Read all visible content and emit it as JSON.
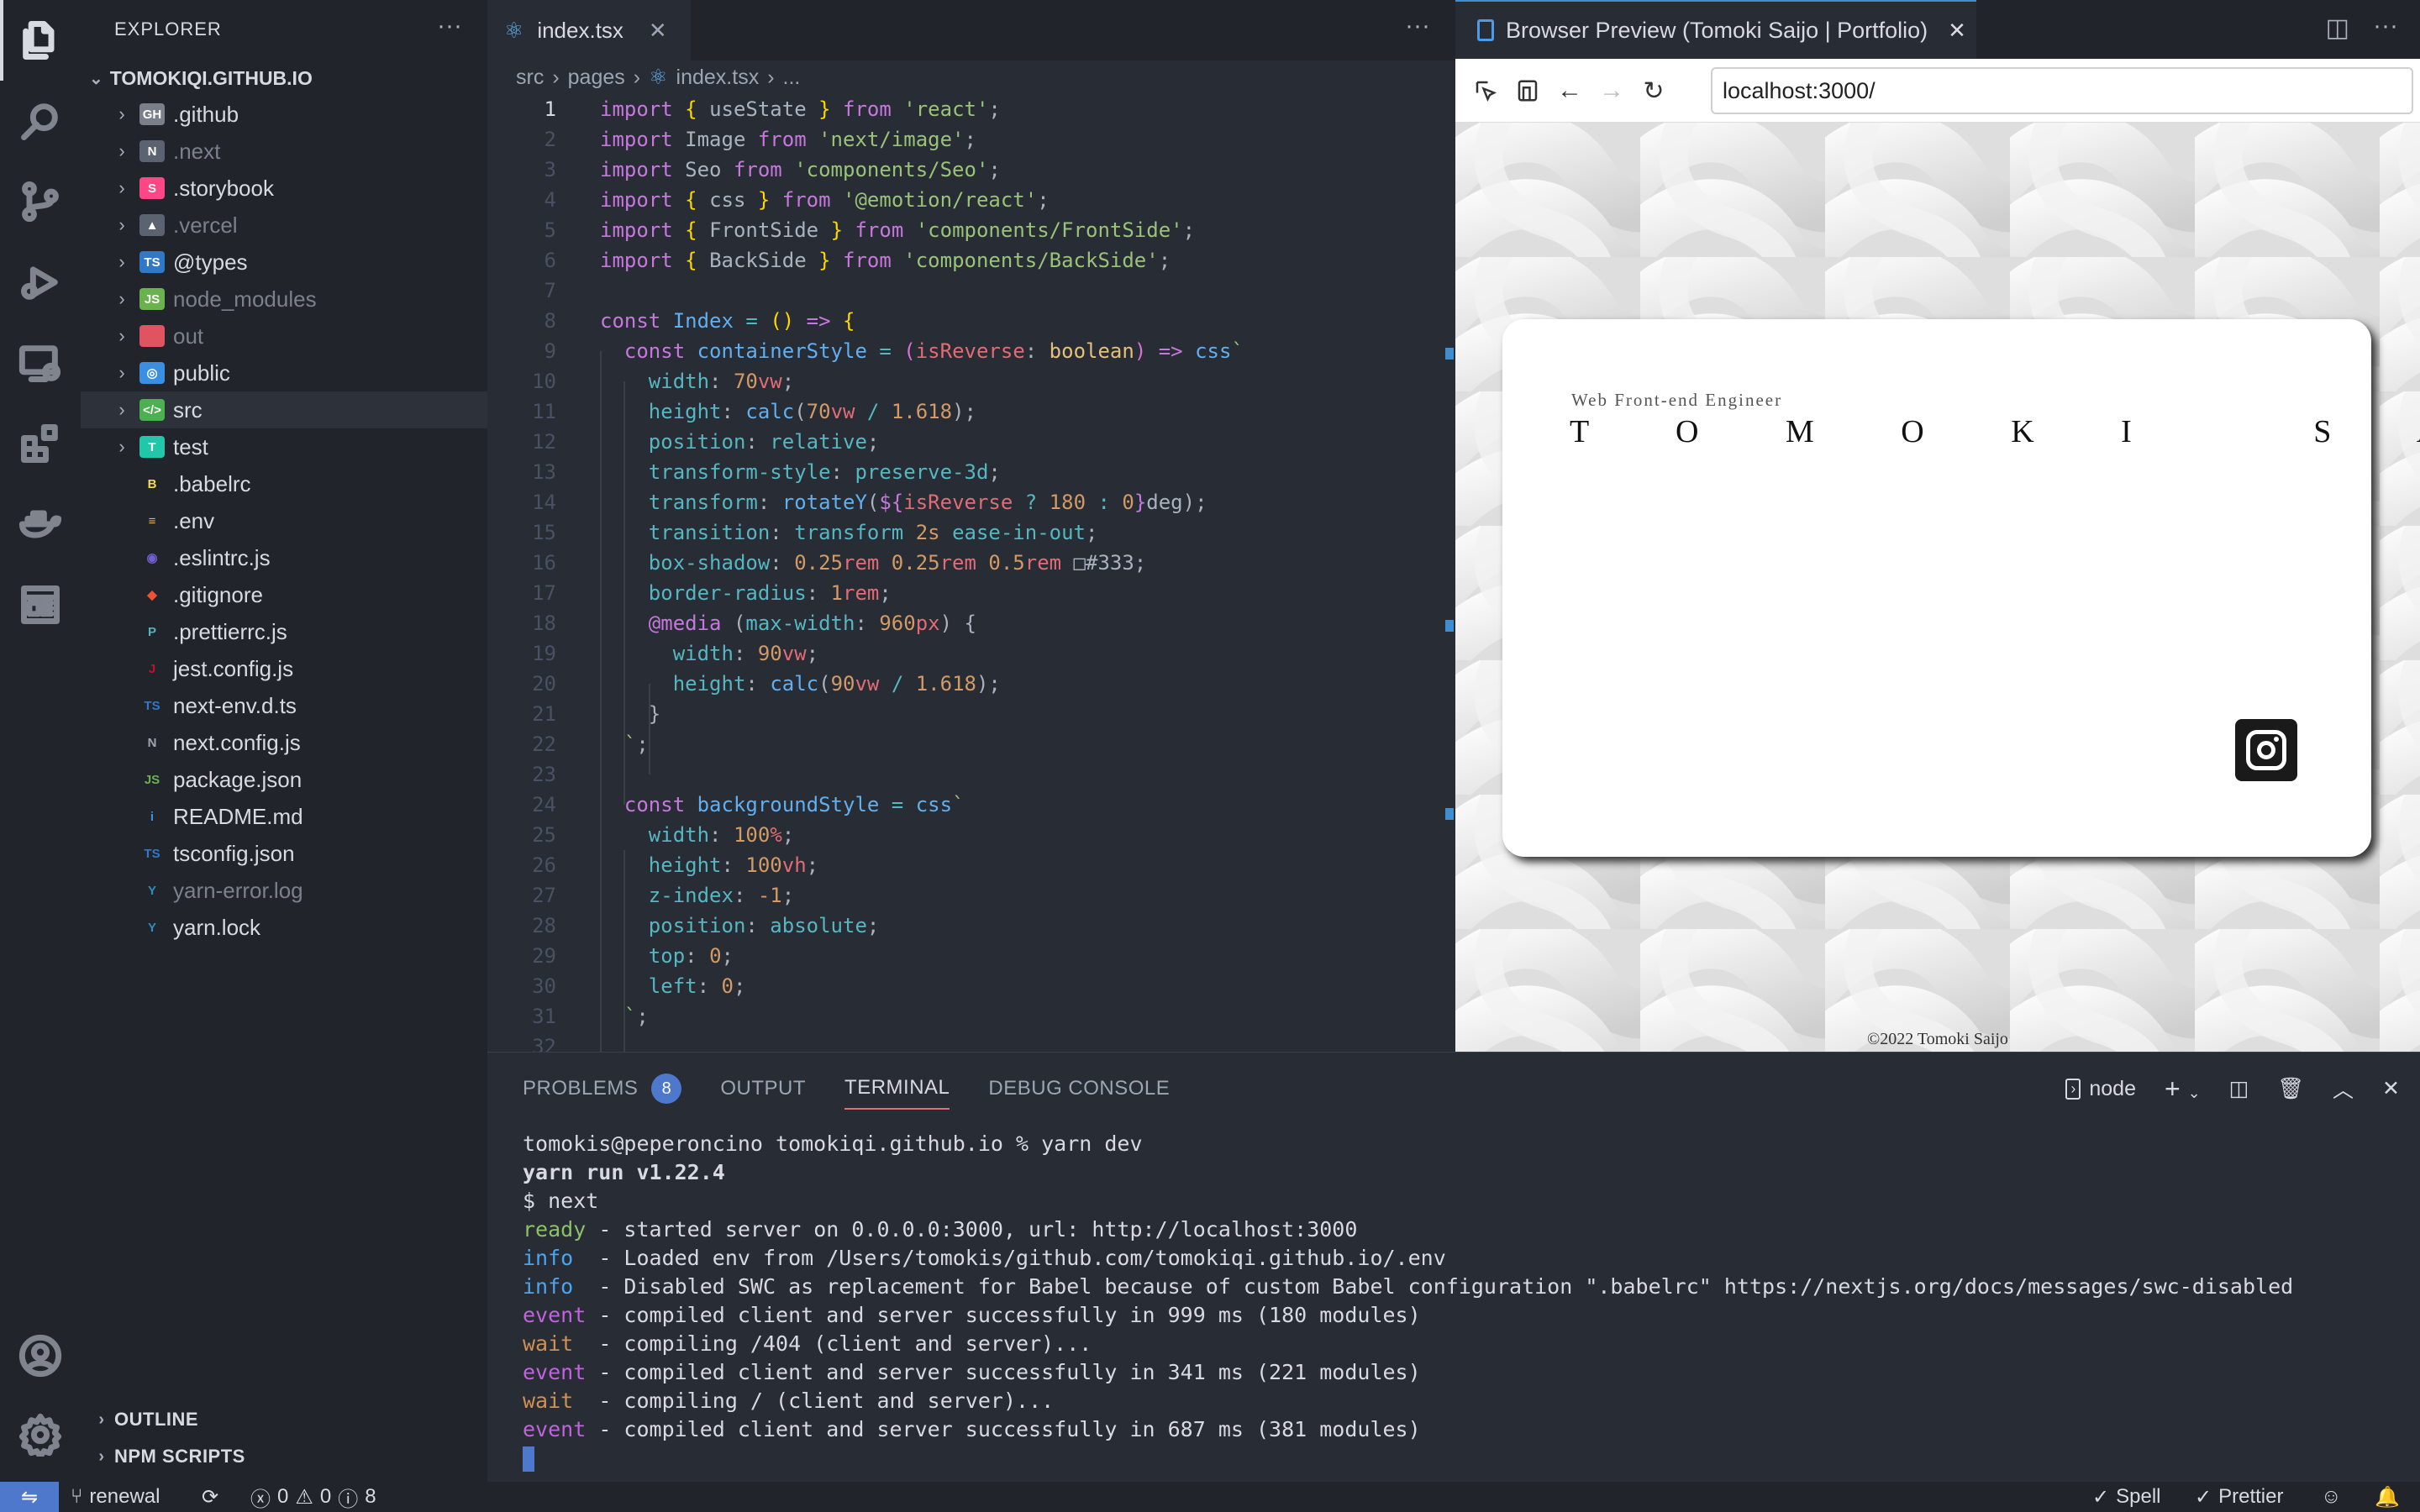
{
  "explorer": {
    "title": "EXPLORER",
    "root": "TOMOKIQI.GITHUB.IO",
    "items": [
      {
        "label": ".github",
        "icon": "GH",
        "color": "#7a7f8a",
        "folder": true,
        "dim": false
      },
      {
        "label": ".next",
        "icon": "N",
        "color": "#5c6370",
        "folder": true,
        "dim": true
      },
      {
        "label": ".storybook",
        "icon": "S",
        "color": "#ff4785",
        "folder": true,
        "dim": false
      },
      {
        "label": ".vercel",
        "icon": "▲",
        "color": "#5c6370",
        "folder": true,
        "dim": true
      },
      {
        "label": "@types",
        "icon": "TS",
        "color": "#3178c6",
        "folder": true,
        "dim": false
      },
      {
        "label": "node_modules",
        "icon": "JS",
        "color": "#6bb24f",
        "folder": true,
        "dim": true
      },
      {
        "label": "out",
        "icon": "",
        "color": "#e05361",
        "folder": true,
        "dim": true
      },
      {
        "label": "public",
        "icon": "◎",
        "color": "#3b8fe0",
        "folder": true,
        "dim": false
      },
      {
        "label": "src",
        "icon": "</>",
        "color": "#4caf50",
        "folder": true,
        "dim": false
      },
      {
        "label": "test",
        "icon": "T",
        "color": "#21c7a8",
        "folder": true,
        "dim": false
      },
      {
        "label": ".babelrc",
        "icon": "B",
        "color": "#f5da55",
        "folder": false,
        "dim": false
      },
      {
        "label": ".env",
        "icon": "≡",
        "color": "#e0b060",
        "folder": false,
        "dim": false
      },
      {
        "label": ".eslintrc.js",
        "icon": "◉",
        "color": "#6f5fd1",
        "folder": false,
        "dim": false
      },
      {
        "label": ".gitignore",
        "icon": "◆",
        "color": "#f05133",
        "folder": false,
        "dim": false
      },
      {
        "label": ".prettierrc.js",
        "icon": "P",
        "color": "#56b3b4",
        "folder": false,
        "dim": false
      },
      {
        "label": "jest.config.js",
        "icon": "J",
        "color": "#c21325",
        "folder": false,
        "dim": false
      },
      {
        "label": "next-env.d.ts",
        "icon": "TS",
        "color": "#3178c6",
        "folder": false,
        "dim": false
      },
      {
        "label": "next.config.js",
        "icon": "N",
        "color": "#9da5b4",
        "folder": false,
        "dim": false
      },
      {
        "label": "package.json",
        "icon": "JS",
        "color": "#6bb24f",
        "folder": false,
        "dim": false
      },
      {
        "label": "README.md",
        "icon": "i",
        "color": "#3b8fe0",
        "folder": false,
        "dim": false
      },
      {
        "label": "tsconfig.json",
        "icon": "TS",
        "color": "#3178c6",
        "folder": false,
        "dim": false
      },
      {
        "label": "yarn-error.log",
        "icon": "Y",
        "color": "#2c8ebb",
        "folder": false,
        "dim": true
      },
      {
        "label": "yarn.lock",
        "icon": "Y",
        "color": "#2c8ebb",
        "folder": false,
        "dim": false
      }
    ],
    "outline": "OUTLINE",
    "npm_scripts": "NPM SCRIPTS"
  },
  "editor": {
    "tab_label": "index.tsx",
    "breadcrumb": [
      "src",
      "pages",
      "index.tsx",
      "..."
    ]
  },
  "code_lines": [
    [
      [
        "k",
        "import "
      ],
      [
        "b1",
        "{ "
      ],
      [
        "p",
        "useState "
      ],
      [
        "b1",
        "} "
      ],
      [
        "k",
        "from "
      ],
      [
        "s",
        "'react'"
      ],
      [
        "p",
        ";"
      ]
    ],
    [
      [
        "k",
        "import "
      ],
      [
        "p",
        "Image "
      ],
      [
        "k",
        "from "
      ],
      [
        "s",
        "'next/image'"
      ],
      [
        "p",
        ";"
      ]
    ],
    [
      [
        "k",
        "import "
      ],
      [
        "p",
        "Seo "
      ],
      [
        "k",
        "from "
      ],
      [
        "s",
        "'components/Seo'"
      ],
      [
        "p",
        ";"
      ]
    ],
    [
      [
        "k",
        "import "
      ],
      [
        "b1",
        "{ "
      ],
      [
        "p",
        "css "
      ],
      [
        "b1",
        "} "
      ],
      [
        "k",
        "from "
      ],
      [
        "s",
        "'@emotion/react'"
      ],
      [
        "p",
        ";"
      ]
    ],
    [
      [
        "k",
        "import "
      ],
      [
        "b1",
        "{ "
      ],
      [
        "p",
        "FrontSide "
      ],
      [
        "b1",
        "} "
      ],
      [
        "k",
        "from "
      ],
      [
        "s",
        "'components/FrontSide'"
      ],
      [
        "p",
        ";"
      ]
    ],
    [
      [
        "k",
        "import "
      ],
      [
        "b1",
        "{ "
      ],
      [
        "p",
        "BackSide "
      ],
      [
        "b1",
        "} "
      ],
      [
        "k",
        "from "
      ],
      [
        "s",
        "'components/BackSide'"
      ],
      [
        "p",
        ";"
      ]
    ],
    [],
    [
      [
        "k",
        "const "
      ],
      [
        "f",
        "Index "
      ],
      [
        "c",
        "= "
      ],
      [
        "b1",
        "() "
      ],
      [
        "k",
        "=> "
      ],
      [
        "b1",
        "{"
      ]
    ],
    [
      [
        "p",
        "  "
      ],
      [
        "k",
        "const "
      ],
      [
        "f",
        "containerStyle "
      ],
      [
        "c",
        "= "
      ],
      [
        "b2",
        "("
      ],
      [
        "v",
        "isReverse"
      ],
      [
        "p",
        ": "
      ],
      [
        "y",
        "boolean"
      ],
      [
        "b2",
        ")"
      ],
      [
        "k",
        " => "
      ],
      [
        "f",
        "css"
      ],
      [
        "s",
        "`"
      ]
    ],
    [
      [
        "p",
        "    "
      ],
      [
        "c",
        "width"
      ],
      [
        "p",
        ": "
      ],
      [
        "n",
        "70"
      ],
      [
        "v",
        "vw"
      ],
      [
        "p",
        ";"
      ]
    ],
    [
      [
        "p",
        "    "
      ],
      [
        "c",
        "height"
      ],
      [
        "p",
        ": "
      ],
      [
        "f",
        "calc"
      ],
      [
        "p",
        "("
      ],
      [
        "n",
        "70"
      ],
      [
        "v",
        "vw "
      ],
      [
        "c",
        "/ "
      ],
      [
        "n",
        "1.618"
      ],
      [
        "p",
        ");"
      ]
    ],
    [
      [
        "p",
        "    "
      ],
      [
        "c",
        "position"
      ],
      [
        "p",
        ": "
      ],
      [
        "c",
        "relative"
      ],
      [
        "p",
        ";"
      ]
    ],
    [
      [
        "p",
        "    "
      ],
      [
        "c",
        "transform-style"
      ],
      [
        "p",
        ": "
      ],
      [
        "c",
        "preserve-3d"
      ],
      [
        "p",
        ";"
      ]
    ],
    [
      [
        "p",
        "    "
      ],
      [
        "c",
        "transform"
      ],
      [
        "p",
        ": "
      ],
      [
        "f",
        "rotateY"
      ],
      [
        "p",
        "("
      ],
      [
        "k",
        "${"
      ],
      [
        "v",
        "isReverse "
      ],
      [
        "c",
        "? "
      ],
      [
        "n",
        "180 "
      ],
      [
        "c",
        ": "
      ],
      [
        "n",
        "0"
      ],
      [
        "k",
        "}"
      ],
      [
        "p",
        "deg);"
      ]
    ],
    [
      [
        "p",
        "    "
      ],
      [
        "c",
        "transition"
      ],
      [
        "p",
        ": "
      ],
      [
        "c",
        "transform "
      ],
      [
        "n",
        "2s "
      ],
      [
        "c",
        "ease-in-out"
      ],
      [
        "p",
        ";"
      ]
    ],
    [
      [
        "p",
        "    "
      ],
      [
        "c",
        "box-shadow"
      ],
      [
        "p",
        ": "
      ],
      [
        "n",
        "0.25"
      ],
      [
        "v",
        "rem "
      ],
      [
        "n",
        "0.25"
      ],
      [
        "v",
        "rem "
      ],
      [
        "n",
        "0.5"
      ],
      [
        "v",
        "rem "
      ],
      [
        "p",
        "□#333;"
      ]
    ],
    [
      [
        "p",
        "    "
      ],
      [
        "c",
        "border-radius"
      ],
      [
        "p",
        ": "
      ],
      [
        "n",
        "1"
      ],
      [
        "v",
        "rem"
      ],
      [
        "p",
        ";"
      ]
    ],
    [
      [
        "p",
        "    "
      ],
      [
        "k",
        "@media "
      ],
      [
        "p",
        "("
      ],
      [
        "c",
        "max-width"
      ],
      [
        "p",
        ": "
      ],
      [
        "n",
        "960"
      ],
      [
        "v",
        "px"
      ],
      [
        "p",
        ") {"
      ]
    ],
    [
      [
        "p",
        "      "
      ],
      [
        "c",
        "width"
      ],
      [
        "p",
        ": "
      ],
      [
        "n",
        "90"
      ],
      [
        "v",
        "vw"
      ],
      [
        "p",
        ";"
      ]
    ],
    [
      [
        "p",
        "      "
      ],
      [
        "c",
        "height"
      ],
      [
        "p",
        ": "
      ],
      [
        "f",
        "calc"
      ],
      [
        "p",
        "("
      ],
      [
        "n",
        "90"
      ],
      [
        "v",
        "vw "
      ],
      [
        "c",
        "/ "
      ],
      [
        "n",
        "1.618"
      ],
      [
        "p",
        ");"
      ]
    ],
    [
      [
        "p",
        "    }"
      ]
    ],
    [
      [
        "p",
        "  "
      ],
      [
        "s",
        "`"
      ],
      [
        "p",
        ";"
      ]
    ],
    [],
    [
      [
        "p",
        "  "
      ],
      [
        "k",
        "const "
      ],
      [
        "f",
        "backgroundStyle "
      ],
      [
        "c",
        "= "
      ],
      [
        "f",
        "css"
      ],
      [
        "s",
        "`"
      ]
    ],
    [
      [
        "p",
        "    "
      ],
      [
        "c",
        "width"
      ],
      [
        "p",
        ": "
      ],
      [
        "n",
        "100"
      ],
      [
        "v",
        "%"
      ],
      [
        "p",
        ";"
      ]
    ],
    [
      [
        "p",
        "    "
      ],
      [
        "c",
        "height"
      ],
      [
        "p",
        ": "
      ],
      [
        "n",
        "100"
      ],
      [
        "v",
        "vh"
      ],
      [
        "p",
        ";"
      ]
    ],
    [
      [
        "p",
        "    "
      ],
      [
        "c",
        "z-index"
      ],
      [
        "p",
        ": "
      ],
      [
        "n",
        "-1"
      ],
      [
        "p",
        ";"
      ]
    ],
    [
      [
        "p",
        "    "
      ],
      [
        "c",
        "position"
      ],
      [
        "p",
        ": "
      ],
      [
        "c",
        "absolute"
      ],
      [
        "p",
        ";"
      ]
    ],
    [
      [
        "p",
        "    "
      ],
      [
        "c",
        "top"
      ],
      [
        "p",
        ": "
      ],
      [
        "n",
        "0"
      ],
      [
        "p",
        ";"
      ]
    ],
    [
      [
        "p",
        "    "
      ],
      [
        "c",
        "left"
      ],
      [
        "p",
        ": "
      ],
      [
        "n",
        "0"
      ],
      [
        "p",
        ";"
      ]
    ],
    [
      [
        "p",
        "  "
      ],
      [
        "s",
        "`"
      ],
      [
        "p",
        ";"
      ]
    ],
    []
  ],
  "preview": {
    "tab_title": "Browser Preview (Tomoki Saijo | Portfolio)",
    "url": "localhost:3000/",
    "role": "Web Front-end Engineer",
    "name": "T O M O K I   S A I J O",
    "copyright": "©2022 Tomoki Saijo"
  },
  "panel": {
    "tabs": [
      "PROBLEMS",
      "OUTPUT",
      "TERMINAL",
      "DEBUG CONSOLE"
    ],
    "problems_count": "8",
    "shell": "node",
    "terminal": [
      [
        [
          "",
          "tomokis@peperoncino tomokiqi.github.io % yarn dev"
        ]
      ],
      [
        [
          "bold",
          "yarn run v1.22.4"
        ]
      ],
      [
        [
          "",
          "$ next"
        ]
      ],
      [
        [
          "tg",
          "ready"
        ],
        [
          "",
          " - started server on 0.0.0.0:3000, url: http://localhost:3000"
        ]
      ],
      [
        [
          "tc",
          "info"
        ],
        [
          "",
          "  - Loaded env from /Users/tomokis/github.com/tomokiqi.github.io/.env"
        ]
      ],
      [
        [
          "tc",
          "info"
        ],
        [
          "",
          "  - Disabled SWC as replacement for Babel because of custom Babel configuration \".babelrc\" https://nextjs.org/docs/messages/swc-disabled"
        ]
      ],
      [
        [
          "tm",
          "event"
        ],
        [
          "",
          " - compiled client and server successfully in 999 ms (180 modules)"
        ]
      ],
      [
        [
          "ty",
          "wait"
        ],
        [
          "",
          "  - compiling /404 (client and server)..."
        ]
      ],
      [
        [
          "tm",
          "event"
        ],
        [
          "",
          " - compiled client and server successfully in 341 ms (221 modules)"
        ]
      ],
      [
        [
          "ty",
          "wait"
        ],
        [
          "",
          "  - compiling / (client and server)..."
        ]
      ],
      [
        [
          "tm",
          "event"
        ],
        [
          "",
          " - compiled client and server successfully in 687 ms (381 modules)"
        ]
      ]
    ]
  },
  "status": {
    "branch": "renewal",
    "errors": "0",
    "warnings": "0",
    "infos": "8",
    "spell": "Spell",
    "prettier": "Prettier"
  }
}
